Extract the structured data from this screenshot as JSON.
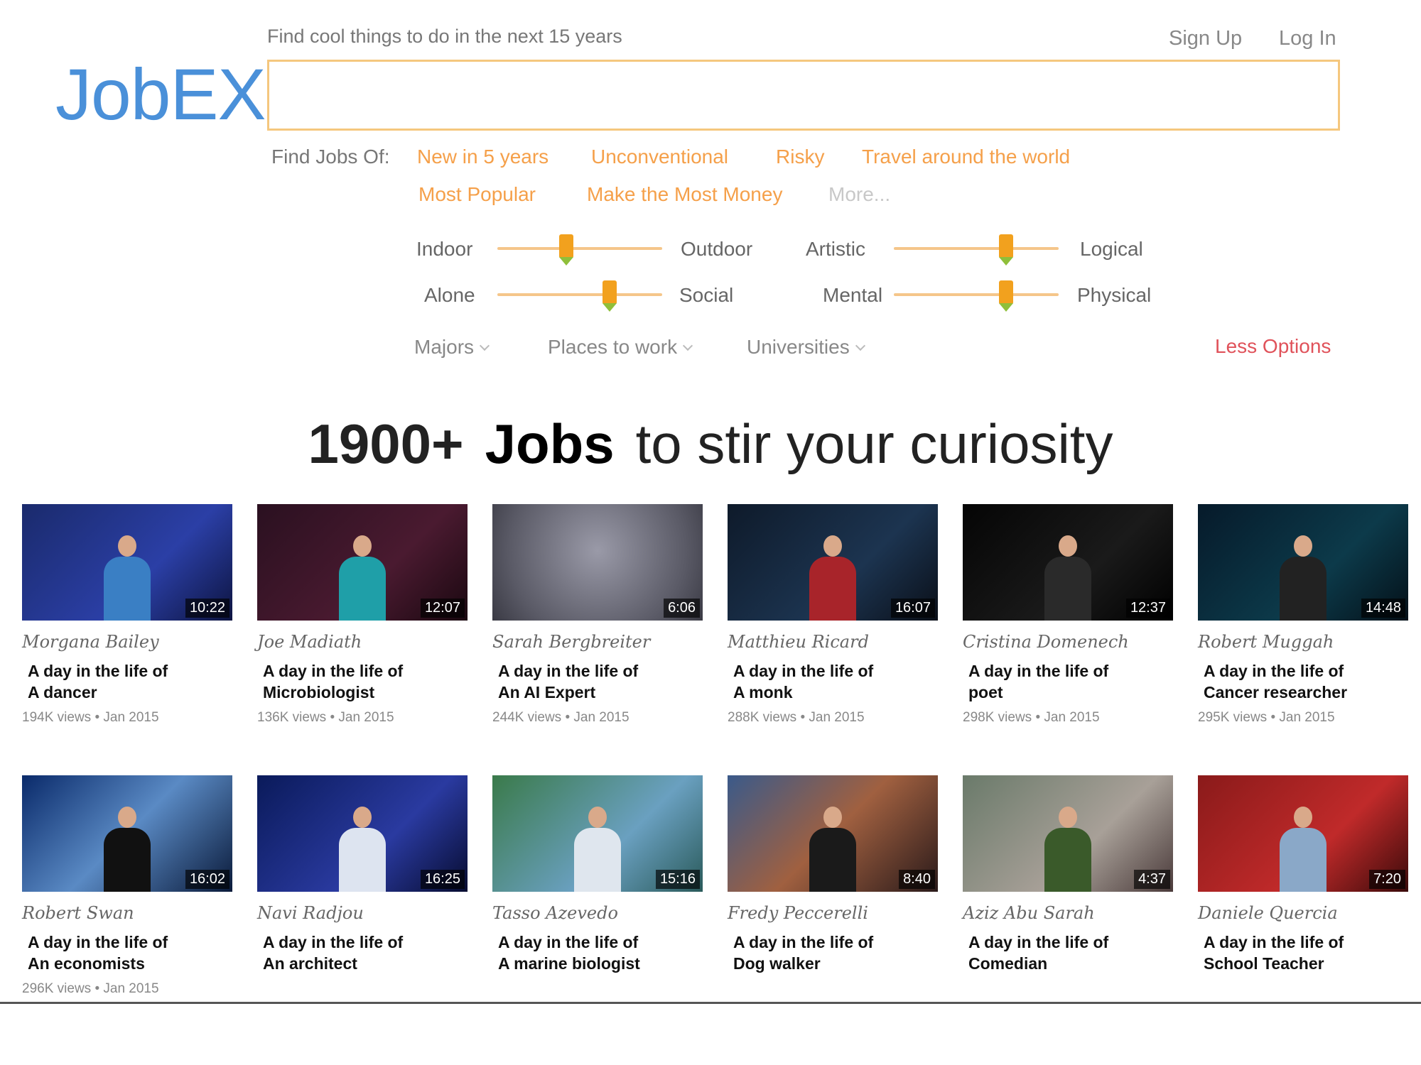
{
  "logo": "JobEX",
  "search": {
    "hint": "Find cool things to do in the next 15 years",
    "placeholder": ""
  },
  "auth": {
    "signup": "Sign Up",
    "login": "Log In"
  },
  "categories": {
    "label": "Find Jobs Of:",
    "items": [
      "New in 5 years",
      "Unconventional",
      "Risky",
      "Travel around the world",
      "Most Popular",
      "Make the Most Money"
    ],
    "more": "More..."
  },
  "sliders": [
    {
      "left": "Indoor",
      "right": "Outdoor",
      "value": 0.42
    },
    {
      "left": "Artistic",
      "right": "Logical",
      "value": 0.68
    },
    {
      "left": "Alone",
      "right": "Social",
      "value": 0.68
    },
    {
      "left": "Mental",
      "right": "Physical",
      "value": 0.68
    }
  ],
  "dropdowns": [
    "Majors",
    "Places to work",
    "Universities"
  ],
  "less_options": "Less Options",
  "headline": {
    "count": "1900+",
    "jobs": "Jobs",
    "rest": "to stir your curiosity"
  },
  "colors": {
    "accent": "#f5a04a",
    "logo": "#4a90d9",
    "less_options": "#e0525a",
    "slider_thumb": "#f2a11e"
  },
  "videos": [
    {
      "speaker": "Morgana Bailey",
      "line1": "A day in the life of",
      "line2": "A dancer",
      "meta": "194K views • Jan 2015",
      "duration": "10:22"
    },
    {
      "speaker": "Joe Madiath",
      "line1": "A day in the life of",
      "line2": "Microbiologist",
      "meta": "136K views • Jan 2015",
      "duration": "12:07"
    },
    {
      "speaker": "Sarah Bergbreiter",
      "line1": "A day in the life of",
      "line2": "An AI Expert",
      "meta": "244K views • Jan 2015",
      "duration": "6:06"
    },
    {
      "speaker": "Matthieu Ricard",
      "line1": "A day in the life of",
      "line2": "A monk",
      "meta": "288K views • Jan 2015",
      "duration": "16:07"
    },
    {
      "speaker": "Cristina Domenech",
      "line1": "A day in the life of",
      "line2": "poet",
      "meta": "298K views • Jan 2015",
      "duration": "12:37"
    },
    {
      "speaker": "Robert Muggah",
      "line1": "A day in the life of",
      "line2": "Cancer researcher",
      "meta": "295K views • Jan 2015",
      "duration": "14:48"
    },
    {
      "speaker": "Robert Swan",
      "line1": "A day in the life of",
      "line2": "An economists",
      "meta": "296K views • Jan 2015",
      "duration": "16:02"
    },
    {
      "speaker": "Navi Radjou",
      "line1": "A day in the life of",
      "line2": "An architect",
      "meta": "",
      "duration": "16:25"
    },
    {
      "speaker": "Tasso Azevedo",
      "line1": "A day in the life of",
      "line2": "A marine biologist",
      "meta": "",
      "duration": "15:16"
    },
    {
      "speaker": "Fredy Peccerelli",
      "line1": "A day in the life of",
      "line2": "Dog walker",
      "meta": "",
      "duration": "8:40"
    },
    {
      "speaker": "Aziz Abu Sarah",
      "line1": "A day in the life of",
      "line2": "Comedian",
      "meta": "",
      "duration": "4:37"
    },
    {
      "speaker": "Daniele Quercia",
      "line1": "A day in the life of",
      "line2": "School Teacher",
      "meta": "",
      "duration": "7:20"
    }
  ]
}
